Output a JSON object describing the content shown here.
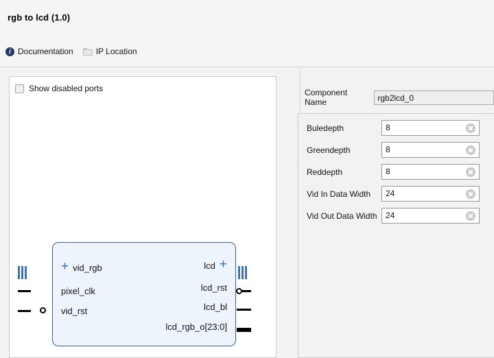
{
  "header": {
    "title": "rgb to lcd (1.0)",
    "links": [
      {
        "label": "Documentation",
        "icon": "info-icon"
      },
      {
        "label": "IP Location",
        "icon": "folder-icon"
      }
    ]
  },
  "diagram_panel": {
    "show_disabled_ports": {
      "label": "Show disabled ports",
      "checked": false
    },
    "block": {
      "left_ports": [
        {
          "name": "vid_rgb",
          "marker": "bus-expand",
          "expander": "+"
        },
        {
          "name": "pixel_clk",
          "marker": "line"
        },
        {
          "name": "vid_rst",
          "marker": "circle"
        }
      ],
      "right_ports": [
        {
          "name": "lcd",
          "marker": "bus-expand",
          "expander": "+"
        },
        {
          "name": "lcd_rst",
          "marker": "circle"
        },
        {
          "name": "lcd_bl",
          "marker": "line"
        },
        {
          "name": "lcd_rgb_o[23:0]",
          "marker": "bus-line"
        }
      ]
    }
  },
  "properties_panel": {
    "component_name": {
      "label": "Component Name",
      "value": "rgb2lcd_0"
    },
    "parameters": [
      {
        "label": "Buledepth",
        "value": "8"
      },
      {
        "label": "Greendepth",
        "value": "8"
      },
      {
        "label": "Reddepth",
        "value": "8"
      },
      {
        "label": "Vid In Data Width",
        "value": "24"
      },
      {
        "label": "Vid Out Data Width",
        "value": "24"
      }
    ]
  },
  "colors": {
    "block_fill": "#eef4fb",
    "block_border": "#3a5c96",
    "bus_marker": "#3f72b0",
    "accent_plus": "#2f6bb5",
    "info_icon": "#23386b",
    "window_bg": "#f2f2f2"
  }
}
